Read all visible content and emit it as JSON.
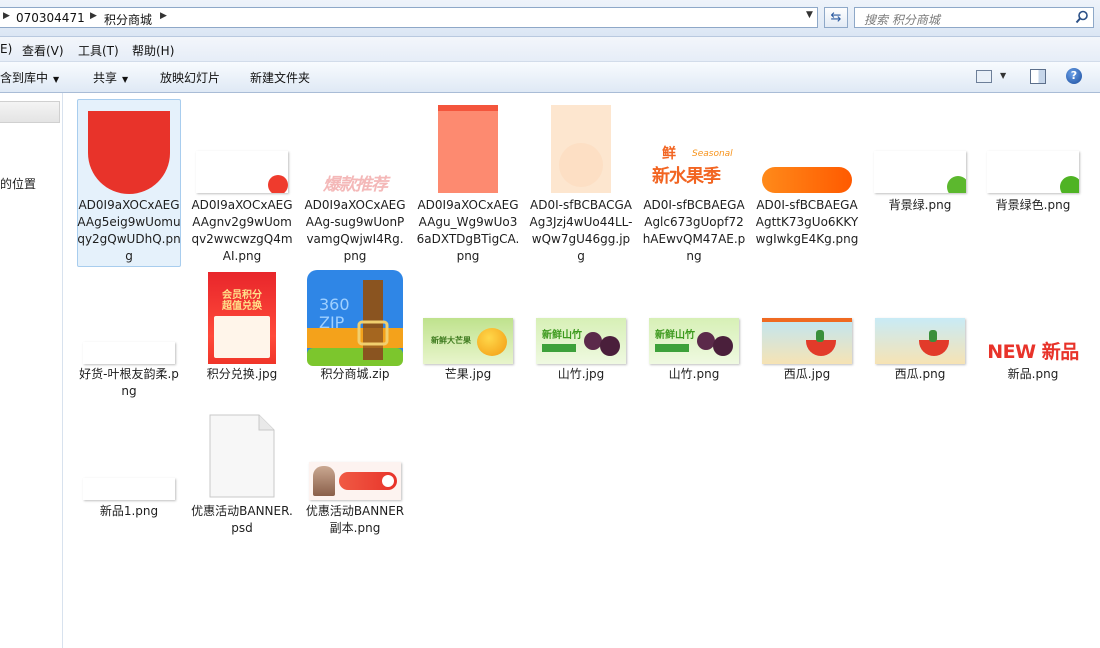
{
  "address": {
    "crumbs": [
      "070304471",
      "积分商城"
    ],
    "refresh_icon": "refresh-icon",
    "search_placeholder": "搜索 积分商城",
    "search_icon": "search-icon"
  },
  "menu": {
    "items": [
      "E)",
      "查看(V)",
      "工具(T)",
      "帮助(H)"
    ]
  },
  "toolbar": {
    "include_library": "含到库中",
    "share": "共享",
    "slideshow": "放映幻灯片",
    "new_folder": "新建文件夹",
    "view_icon": "views-icon",
    "pane_icon": "preview-pane-icon",
    "help_icon": "help-icon",
    "help_glyph": "?"
  },
  "nav": {
    "location_text": "的位置"
  },
  "files": [
    {
      "name": "AD0I9aXOCxAEGAAg5eig9wUomuqy2gQwUDhQ.png"
    },
    {
      "name": "AD0I9aXOCxAEGAAgnv2g9wUomqv2wwcwzgQ4mAI.png"
    },
    {
      "name": "AD0I9aXOCxAEGAAg-sug9wUonPvamgQwjwI4Rg.png"
    },
    {
      "name": "AD0I9aXOCxAEGAAgu_Wg9wUo36aDXTDgBTigCA.png"
    },
    {
      "name": "AD0I-sfBCBACGAAg3Jzj4wUo44LL-wQw7gU46gg.jpg"
    },
    {
      "name": "AD0I-sfBCBAEGAAglc673gUopf72hAEwvQM47AE.png"
    },
    {
      "name": "AD0I-sfBCBAEGAAgttK73gUo6KKYwgIwkgE4Kg.png"
    },
    {
      "name": "背景绿.png"
    },
    {
      "name": "背景绿色.png"
    },
    {
      "name": "好货-叶根友韵柔.png"
    },
    {
      "name": "积分兑换.jpg"
    },
    {
      "name": "积分商城.zip"
    },
    {
      "name": "芒果.jpg"
    },
    {
      "name": "山竹.jpg"
    },
    {
      "name": "山竹.png"
    },
    {
      "name": "西瓜.jpg"
    },
    {
      "name": "西瓜.png"
    },
    {
      "name": "新品.png"
    },
    {
      "name": "新品1.png"
    },
    {
      "name": "优惠活动BANNER.psd"
    },
    {
      "name": "优惠活动BANNER副本.png"
    }
  ],
  "thumb_text": {
    "hot_recommend": "爆款推荐",
    "seasonal": "Seasonal",
    "xian": "鲜",
    "xinshui": "新水果季",
    "points_banner_line1": "会员积分",
    "points_banner_line2": "超值兑换",
    "zip_logo_line1": "360",
    "zip_logo_line2": "ZIP",
    "mango_banner": "新鲜大芒果",
    "mangosteen_banner": "新鲜山竹",
    "new_text": "NEW 新品"
  },
  "colors": {
    "accent": "#2a5aa0",
    "selection": "#e5f1fb",
    "red": "#e8332a",
    "orange": "#ff7a18",
    "green": "#5cb82e"
  }
}
